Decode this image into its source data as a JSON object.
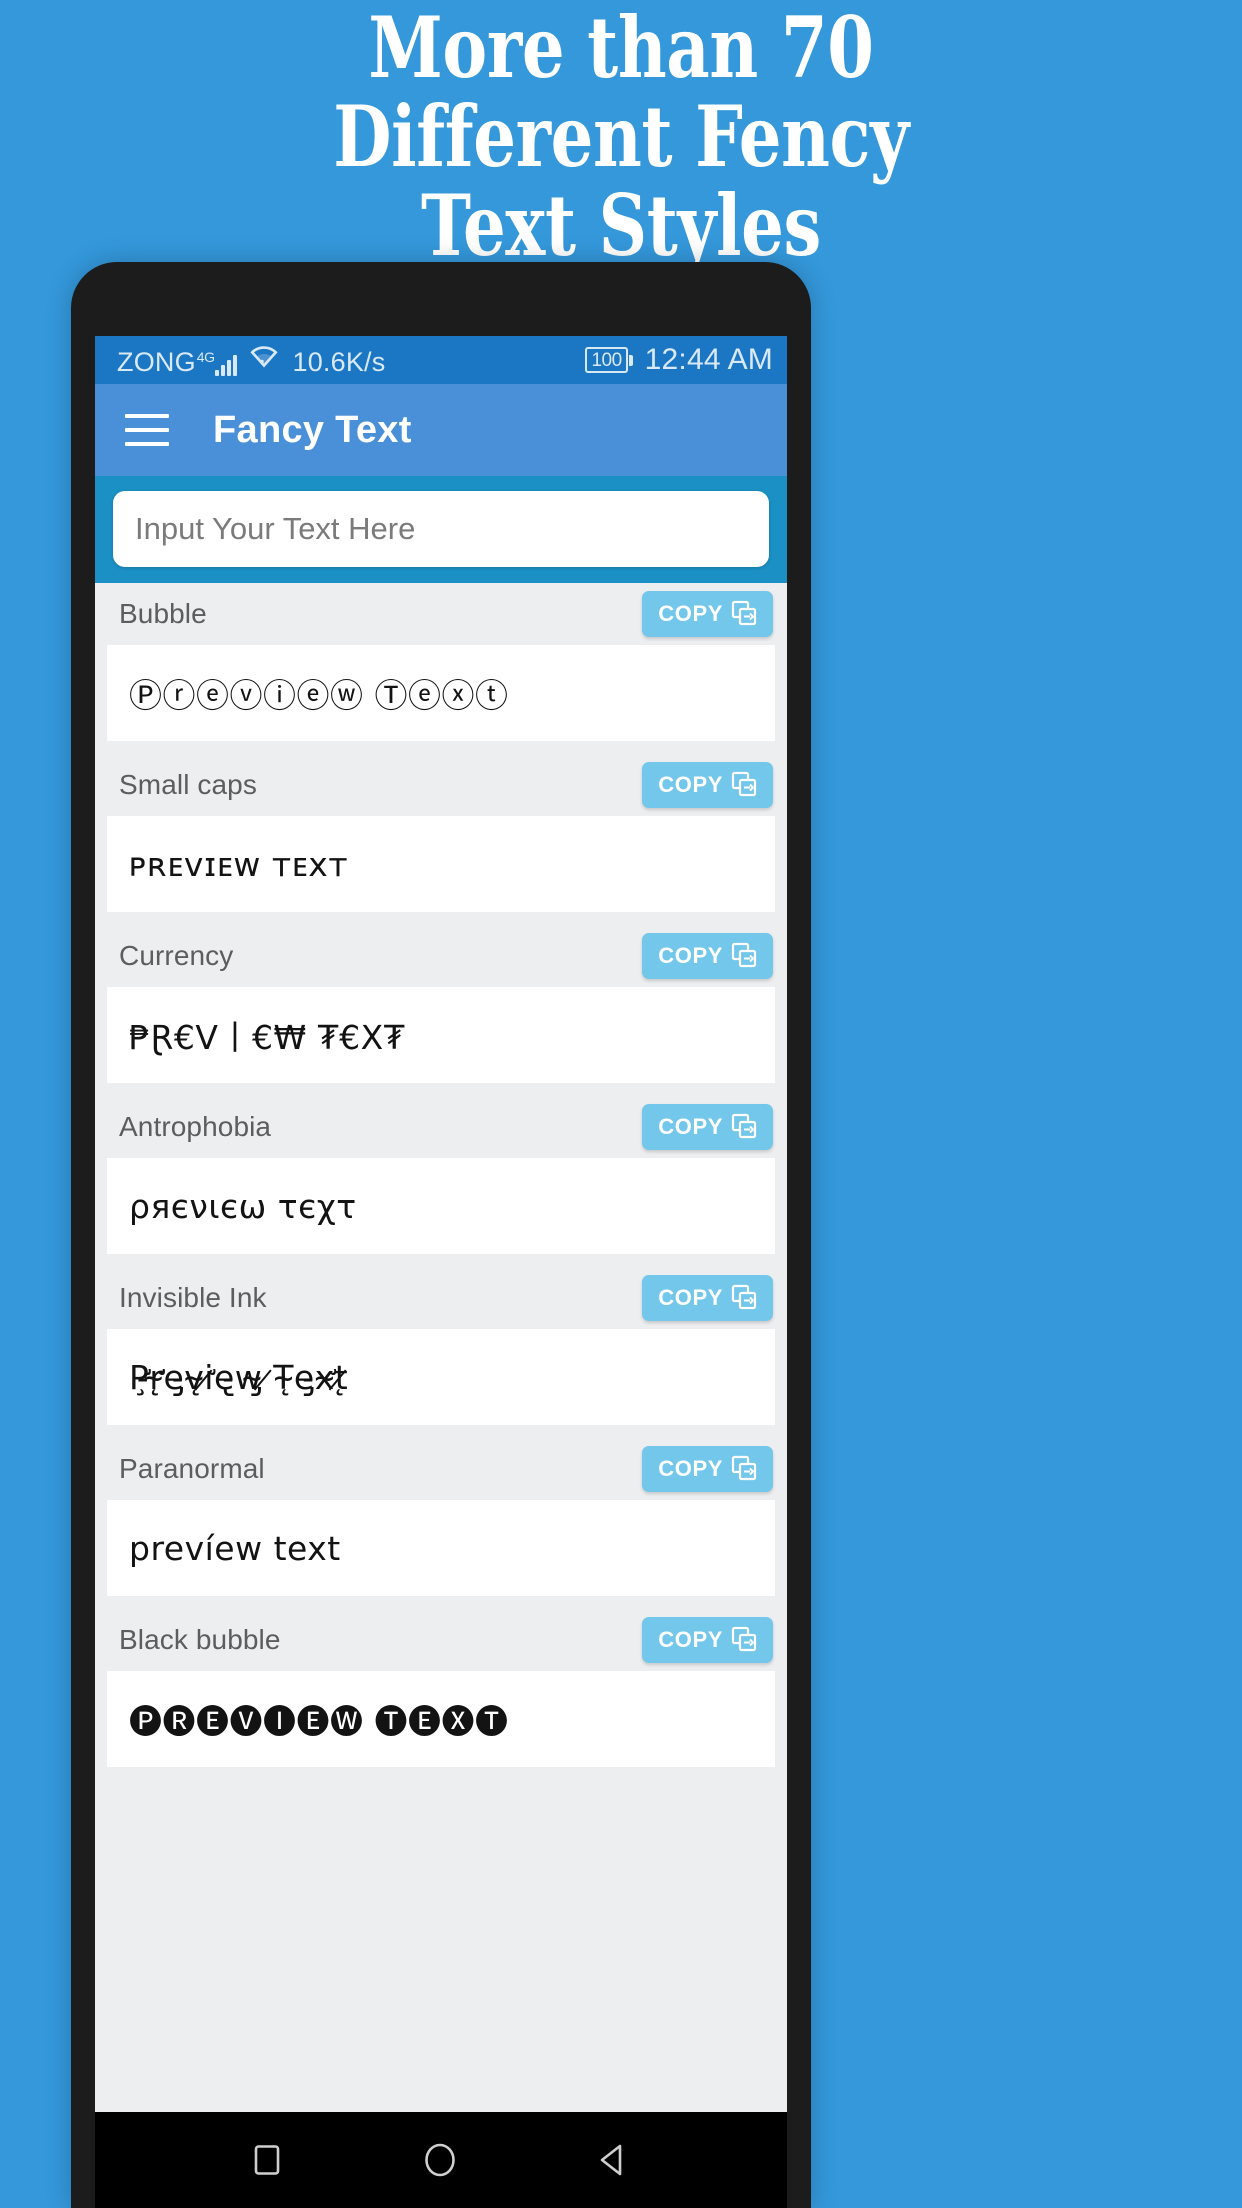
{
  "promo": {
    "lines": [
      "More than 70",
      "Different Fency",
      "Text Styles"
    ],
    "background_color": "#3498db",
    "text_color": "#ffffff"
  },
  "status_bar": {
    "carrier": "ZONG",
    "network_type": "4G",
    "signal_icon": "signal-bars-icon",
    "wifi_icon": "wifi-icon",
    "network_speed": "10.6K/s",
    "battery_level": "100",
    "battery_icon": "battery-icon",
    "clock": "12:44 AM",
    "background_color": "#1b77c4"
  },
  "app_bar": {
    "menu_icon": "hamburger-menu-icon",
    "title": "Fancy Text",
    "background_color": "#4a90d9"
  },
  "input": {
    "placeholder": "Input Your Text Here",
    "value": "",
    "band_color": "#1b90c4"
  },
  "copy_button": {
    "label": "COPY",
    "icon": "copy-icon",
    "color": "#73c7ea"
  },
  "styles": [
    {
      "name": "Bubble",
      "preview": "Ⓟⓡⓔⓥⓘⓔⓦ Ⓣⓔⓧⓣ"
    },
    {
      "name": "Small caps",
      "preview": "ᴘʀᴇᴠɪᴇᴡ ᴛᴇxᴛ"
    },
    {
      "name": "Currency",
      "preview": "₱Ɽ€V丨€₩ ₮€X₮"
    },
    {
      "name": "Antrophobia",
      "preview": "ρяєνιєω τєχτ"
    },
    {
      "name": "Invisible Ink",
      "preview": "P̵̧̛r̴̨̛e̵̡v̴̨i̷̛e̵̢w̴̡ ̷T̴̨e̵̡x̴̛t̷̨"
    },
    {
      "name": "Paranormal",
      "preview": "prevíew text"
    },
    {
      "name": "Black bubble",
      "preview": "🅟🅡🅔🅥🅘🅔🅦 🅣🅔🅧🅣"
    }
  ],
  "nav_bar": {
    "recents_icon": "square-recents-icon",
    "home_icon": "circle-home-icon",
    "back_icon": "triangle-back-icon",
    "background_color": "#000000"
  }
}
